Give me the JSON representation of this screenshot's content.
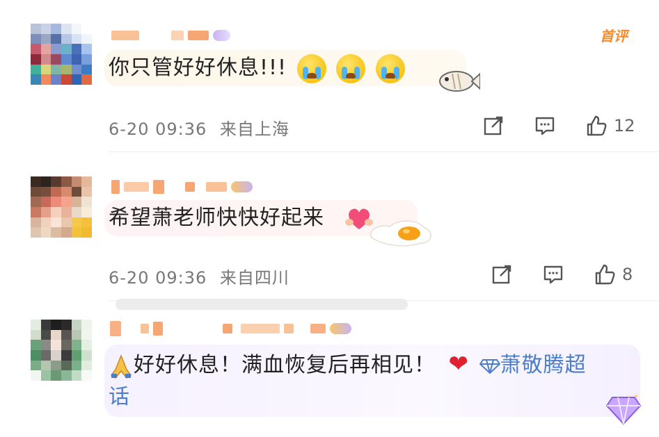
{
  "comments": [
    {
      "text": "你只管好好休息!!!",
      "time": "6-20 09:36",
      "location": "来自上海",
      "likes": "12",
      "tag": "首评"
    },
    {
      "text": "希望萧老师快快好起来",
      "time": "6-20 09:36",
      "location": "来自四川",
      "likes": "8"
    },
    {
      "text_pre": "好好休息！满血恢复后再相见！",
      "supertopic": "萧敬腾超",
      "supertopic_tail": "话"
    }
  ],
  "icons": {
    "share": "share-icon",
    "comment": "comment-icon",
    "like": "thumbs-up-icon"
  },
  "colors": {
    "accent_orange": "#f78a2c",
    "link_blue": "#4a7ec9",
    "meta_gray": "#777777"
  }
}
